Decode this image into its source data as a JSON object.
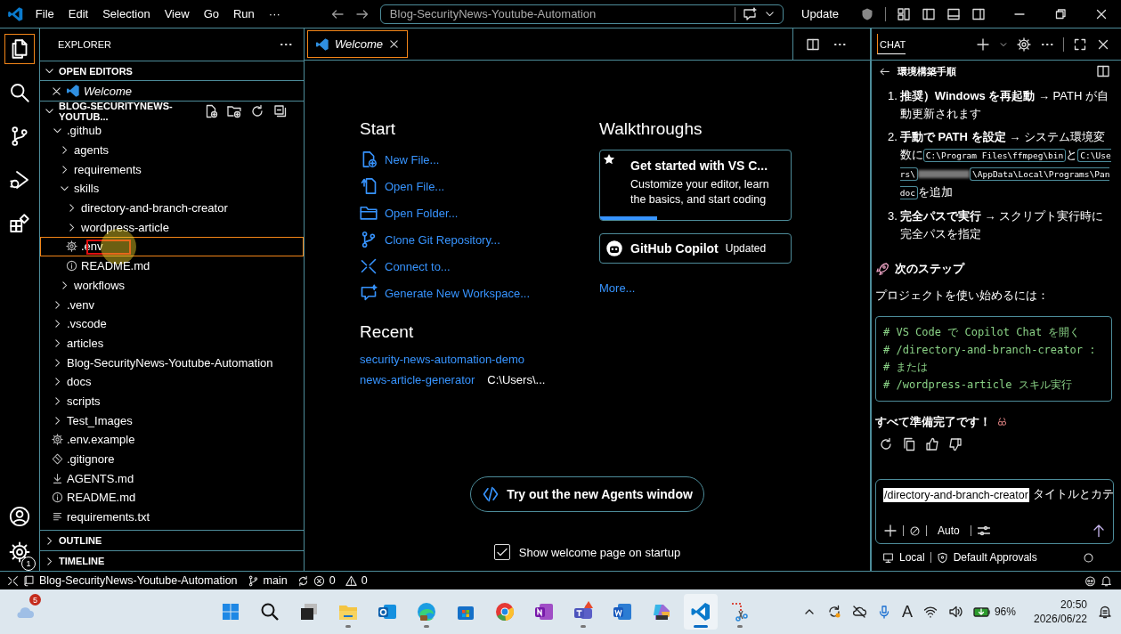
{
  "title_bar": {
    "menu": [
      "File",
      "Edit",
      "Selection",
      "View",
      "Go",
      "Run",
      "···"
    ],
    "command_center": "Blog-SecurityNews-Youtube-Automation",
    "update_button": "Update"
  },
  "activity_bar": [
    {
      "kind": "files",
      "selected": true
    },
    {
      "kind": "search",
      "selected": false
    },
    {
      "kind": "source-control",
      "selected": false
    },
    {
      "kind": "run-debug",
      "selected": false
    },
    {
      "kind": "extensions",
      "selected": false
    }
  ],
  "manage_badge": "1",
  "explorer": {
    "title": "EXPLORER",
    "open_editors": {
      "title": "OPEN EDITORS",
      "expanded": true,
      "items": [
        {
          "name": "Welcome"
        }
      ]
    },
    "folder": {
      "title": "BLOG-SECURITYNEWS-YOUTUB...",
      "expanded": true
    },
    "tree": [
      {
        "name": ".github",
        "kind": "folder",
        "expanded": true,
        "selected": false,
        "children": [
          {
            "name": "agents",
            "kind": "folder",
            "expanded": false,
            "selected": false
          },
          {
            "name": "requirements",
            "kind": "folder",
            "expanded": false,
            "selected": false
          },
          {
            "name": "skills",
            "kind": "folder",
            "expanded": true,
            "selected": false,
            "children": [
              {
                "name": "directory-and-branch-creator",
                "kind": "folder",
                "expanded": false,
                "selected": false
              },
              {
                "name": "wordpress-article",
                "kind": "folder",
                "expanded": false,
                "selected": false
              },
              {
                "name": ".env",
                "kind": "settings",
                "selected": true
              },
              {
                "name": "README.md",
                "kind": "info",
                "selected": false
              }
            ]
          },
          {
            "name": "workflows",
            "kind": "folder",
            "expanded": false,
            "selected": false
          }
        ]
      },
      {
        "name": ".venv",
        "kind": "folder",
        "expanded": false,
        "selected": false
      },
      {
        "name": ".vscode",
        "kind": "folder",
        "expanded": false,
        "selected": false
      },
      {
        "name": "articles",
        "kind": "folder",
        "expanded": false,
        "selected": false
      },
      {
        "name": "Blog-SecurityNews-Youtube-Automation",
        "kind": "folder",
        "expanded": false,
        "selected": false
      },
      {
        "name": "docs",
        "kind": "folder",
        "expanded": false,
        "selected": false
      },
      {
        "name": "scripts",
        "kind": "folder",
        "expanded": false,
        "selected": false
      },
      {
        "name": "Test_Images",
        "kind": "folder",
        "expanded": false,
        "selected": false
      },
      {
        "name": ".env.example",
        "kind": "settings",
        "selected": false
      },
      {
        "name": ".gitignore",
        "kind": "git",
        "selected": false
      },
      {
        "name": "AGENTS.md",
        "kind": "download",
        "selected": false
      },
      {
        "name": "README.md",
        "kind": "info",
        "selected": false
      },
      {
        "name": "requirements.txt",
        "kind": "text",
        "selected": false
      }
    ],
    "sections": [
      {
        "title": "OUTLINE",
        "expanded": false
      },
      {
        "title": "TIMELINE",
        "expanded": false
      }
    ]
  },
  "editor": {
    "tabs": [
      {
        "label": "Welcome",
        "selected": true
      }
    ],
    "start": {
      "title": "Start",
      "items": [
        {
          "kind": "new-file",
          "label": "New File..."
        },
        {
          "kind": "open-file",
          "label": "Open File..."
        },
        {
          "kind": "folder",
          "label": "Open Folder..."
        },
        {
          "kind": "branch",
          "label": "Clone Git Repository..."
        },
        {
          "kind": "remote",
          "label": "Connect to..."
        },
        {
          "kind": "workspace",
          "label": "Generate New Workspace..."
        }
      ]
    },
    "recent": {
      "title": "Recent",
      "items": [
        {
          "name": "security-news-automation-demo"
        },
        {
          "name": "news-article-generator",
          "path": "C:\\Users\\..."
        }
      ]
    },
    "walkthroughs": {
      "title": "Walkthroughs",
      "cards": [
        {
          "kind": "featured",
          "title": "Get started with VS C...",
          "description": "Customize your editor, learn the basics, and start coding",
          "level": 0.3
        },
        {
          "kind": "extension",
          "title": "GitHub Copilot",
          "badge": "Updated"
        }
      ],
      "more": "More..."
    },
    "agents_button": "Try out the new Agents window",
    "show_on_startup": {
      "label": "Show welcome page on startup",
      "checked": true
    }
  },
  "chat": {
    "tab": "CHAT",
    "header": "環境構築手順",
    "steps": [
      {
        "number": "1.",
        "parts": [
          {
            "kind": "text",
            "text": "**推奨）Windows を再起動** → PATH が自動更新されます"
          }
        ]
      },
      {
        "number": "2.",
        "parts": [
          {
            "kind": "text",
            "text": "**手動で PATH を設定** → システム環境変数に"
          },
          {
            "kind": "code",
            "text": "C:\\Program Files\\ffmpeg\\bin"
          },
          {
            "kind": "text",
            "text": "と"
          },
          {
            "kind": "code",
            "text": "C:\\Users\\"
          },
          {
            "kind": "redacted"
          },
          {
            "kind": "code",
            "text": "\\AppData\\Local\\Programs\\Pandoc"
          },
          {
            "kind": "text",
            "text": "を追加"
          }
        ]
      },
      {
        "number": "3.",
        "parts": [
          {
            "kind": "text",
            "text": "**完全パスで実行** → スクリプト実行時に完全パスを指定"
          }
        ]
      }
    ],
    "next_heading": "次のステップ",
    "intro": "プロジェクトを使い始めるには：",
    "code_lines": [
      "# VS Code で Copilot Chat を開く",
      "# /directory-and-branch-creator :",
      "# または",
      "# /wordpress-article スキル実行"
    ],
    "done": "すべて準備完了です！",
    "input": {
      "command": "/directory-and-branch-creator",
      "text": "タイトルとカテ"
    },
    "mode": "Auto",
    "location": "Local",
    "approvals": "Default Approvals"
  },
  "status_bar": {
    "repo": "Blog-SecurityNews-Youtube-Automation",
    "branch": "main",
    "errors": "0",
    "warnings": "0"
  },
  "taskbar": {
    "weather_badge": "5",
    "apps": [
      {
        "kind": "start",
        "running": false,
        "selected": false
      },
      {
        "kind": "search",
        "running": false,
        "selected": false
      },
      {
        "kind": "taskview",
        "running": false,
        "selected": false
      },
      {
        "kind": "files",
        "running": true,
        "selected": false
      },
      {
        "kind": "outlook",
        "running": false,
        "selected": false
      },
      {
        "kind": "edge",
        "running": true,
        "selected": false
      },
      {
        "kind": "store",
        "running": false,
        "selected": false
      },
      {
        "kind": "chrome",
        "running": false,
        "selected": false
      },
      {
        "kind": "onenote",
        "running": false,
        "selected": false
      },
      {
        "kind": "teams",
        "running": true,
        "selected": false
      },
      {
        "kind": "word",
        "running": false,
        "selected": false
      },
      {
        "kind": "m365",
        "running": false,
        "selected": false
      },
      {
        "kind": "vscode",
        "running": true,
        "selected": true
      },
      {
        "kind": "snip",
        "running": true,
        "selected": false
      }
    ],
    "ime": "A",
    "battery": "96%",
    "time": "20:50",
    "date": "2026/06/22"
  }
}
